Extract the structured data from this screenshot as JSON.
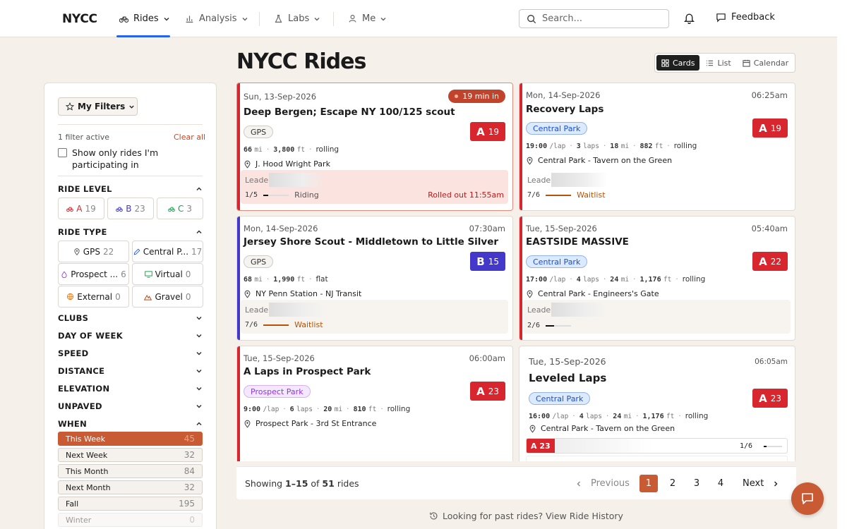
{
  "brand": "NYCC",
  "nav": {
    "rides": "Rides",
    "analysis": "Analysis",
    "labs": "Labs",
    "me": "Me"
  },
  "search": {
    "placeholder": "Search..."
  },
  "feedback": "Feedback",
  "page_title": "NYCC Rides",
  "views": {
    "cards": "Cards",
    "list": "List",
    "calendar": "Calendar",
    "active": "Cards"
  },
  "sidebar": {
    "my_filters": "My Filters",
    "active_count": "1 filter active",
    "clear_all": "Clear all",
    "participating": "Show only rides I'm participating in",
    "ride_level": {
      "title": "RIDE LEVEL",
      "items": [
        {
          "label": "A",
          "count": "19",
          "color": "#d8262f"
        },
        {
          "label": "B",
          "count": "23",
          "color": "#4338ca"
        },
        {
          "label": "C",
          "count": "3",
          "color": "#16a34a"
        }
      ]
    },
    "ride_type": {
      "title": "RIDE TYPE",
      "items": [
        {
          "label": "GPS",
          "count": "22"
        },
        {
          "label": "Central P...",
          "count": "17"
        },
        {
          "label": "Prospect ...",
          "count": "6"
        },
        {
          "label": "Virtual",
          "count": "0"
        },
        {
          "label": "External",
          "count": "0"
        },
        {
          "label": "Gravel",
          "count": "0"
        }
      ]
    },
    "sections": [
      "CLUBS",
      "DAY OF WEEK",
      "SPEED",
      "DISTANCE",
      "ELEVATION",
      "UNPAVED"
    ],
    "when": {
      "title": "WHEN",
      "items": [
        {
          "label": "This Week",
          "count": "45",
          "selected": true
        },
        {
          "label": "Next Week",
          "count": "32"
        },
        {
          "label": "This Month",
          "count": "84"
        },
        {
          "label": "Next Month",
          "count": "32"
        },
        {
          "label": "Fall",
          "count": "195"
        },
        {
          "label": "Winter",
          "count": "0"
        }
      ]
    }
  },
  "rides": [
    {
      "date": "Sun, 13-Sep-2026",
      "live": "19 min in",
      "title": "Deep Bergen; Escape NY 100/125 scout",
      "tag": "GPS",
      "level": "A",
      "level_count": "19",
      "stats": [
        [
          "66",
          "mi"
        ],
        [
          "3,800",
          "ft"
        ]
      ],
      "terrain": "rolling",
      "location": "J. Hood Wright Park",
      "leader": "Leader:",
      "fill": "1/5",
      "progress": 0.2,
      "status": "Riding",
      "rolled": "Rolled out 11:55am"
    },
    {
      "date": "Mon, 14-Sep-2026",
      "time": "06:25am",
      "title": "Recovery Laps",
      "tag": "Central Park",
      "level": "A",
      "level_count": "19",
      "stats": [
        [
          "19:00",
          "/lap"
        ],
        [
          "3",
          "laps"
        ],
        [
          "18",
          "mi"
        ],
        [
          "882",
          "ft"
        ]
      ],
      "terrain": "rolling",
      "location": "Central Park - Tavern on the Green",
      "leader": "Leader:",
      "fill": "7/6",
      "status": "Waitlist"
    },
    {
      "date": "Mon, 14-Sep-2026",
      "time": "07:30am",
      "title": "Jersey Shore Scout - Middletown to Little Silver",
      "tag": "GPS",
      "level": "B",
      "level_count": "15",
      "stats": [
        [
          "68",
          "mi"
        ],
        [
          "1,990",
          "ft"
        ]
      ],
      "terrain": "flat",
      "location": "NY Penn Station - NJ Transit",
      "leader": "Leader:",
      "fill": "7/6",
      "status": "Waitlist"
    },
    {
      "date": "Tue, 15-Sep-2026",
      "time": "05:40am",
      "title": "EASTSIDE MASSIVE",
      "tag": "Central Park",
      "level": "A",
      "level_count": "22",
      "stats": [
        [
          "17:00",
          "/lap"
        ],
        [
          "4",
          "laps"
        ],
        [
          "24",
          "mi"
        ],
        [
          "1,176",
          "ft"
        ]
      ],
      "terrain": "rolling",
      "location": "Central Park - Engineers's Gate",
      "leader": "Leader:",
      "fill": "2/6",
      "progress": 0.33
    },
    {
      "date": "Tue, 15-Sep-2026",
      "time": "06:00am",
      "title": "A Laps in Prospect Park",
      "tag": "Prospect Park",
      "level": "A",
      "level_count": "23",
      "stats": [
        [
          "9:00",
          "/lap"
        ],
        [
          "6",
          "laps"
        ],
        [
          "20",
          "mi"
        ],
        [
          "810",
          "ft"
        ]
      ],
      "terrain": "rolling",
      "location": "Prospect Park - 3rd St Entrance"
    },
    {
      "date": "Tue, 15-Sep-2026",
      "time": "06:05am",
      "title": "Leveled Laps",
      "tag": "Central Park",
      "level": "A",
      "level_count": "23",
      "stats": [
        [
          "16:00",
          "/lap"
        ],
        [
          "4",
          "laps"
        ],
        [
          "24",
          "mi"
        ],
        [
          "1,176",
          "ft"
        ]
      ],
      "terrain": "rolling",
      "location": "Central Park - Tavern on the Green",
      "sub_level": "A 23",
      "sub_fill": "1/6",
      "sub_progress": 0.17
    }
  ],
  "pager": {
    "showing_pre": "Showing",
    "range": "1–15",
    "of": "of",
    "total": "51",
    "unit": "rides",
    "previous": "Previous",
    "pages": [
      "1",
      "2",
      "3",
      "4"
    ],
    "current": "1",
    "next": "Next"
  },
  "history": "Looking for past rides? View Ride History"
}
